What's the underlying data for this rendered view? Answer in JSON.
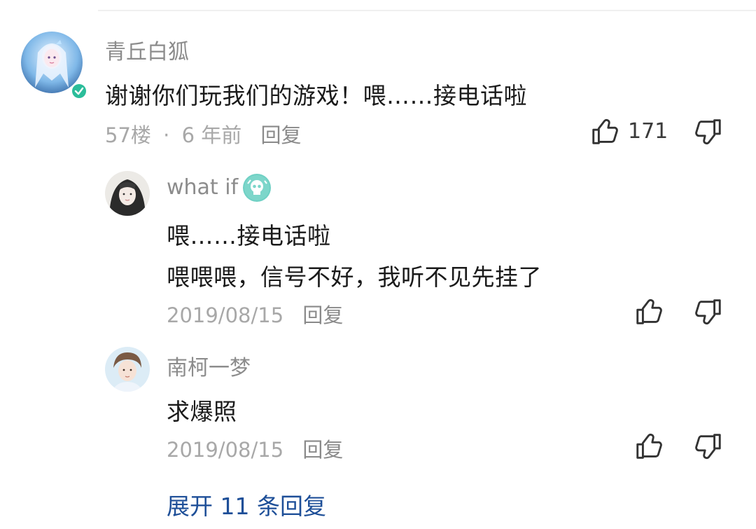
{
  "colors": {
    "link": "#1e4f98",
    "meta": "#a8a8a8",
    "text": "#1a1a1a",
    "verified_badge": "#2bbd9a"
  },
  "main_comment": {
    "username": "青丘白狐",
    "text": "谢谢你们玩我们的游戏！喂……接电话啦",
    "floor": "57楼",
    "separator": "·",
    "time": "6 年前",
    "reply_label": "回复",
    "like_count": "171",
    "verified_icon": "verified-check-icon"
  },
  "replies": [
    {
      "username": "what if",
      "line1": "喂……接电话啦",
      "line2": "喂喂喂，信号不好，我听不见先挂了",
      "date": "2019/08/15",
      "reply_label": "回复",
      "badge_icon": "skull-badge-icon"
    },
    {
      "username": "南柯一梦",
      "line1": "求爆照",
      "date": "2019/08/15",
      "reply_label": "回复"
    }
  ],
  "expand_label": "展开 11 条回复"
}
